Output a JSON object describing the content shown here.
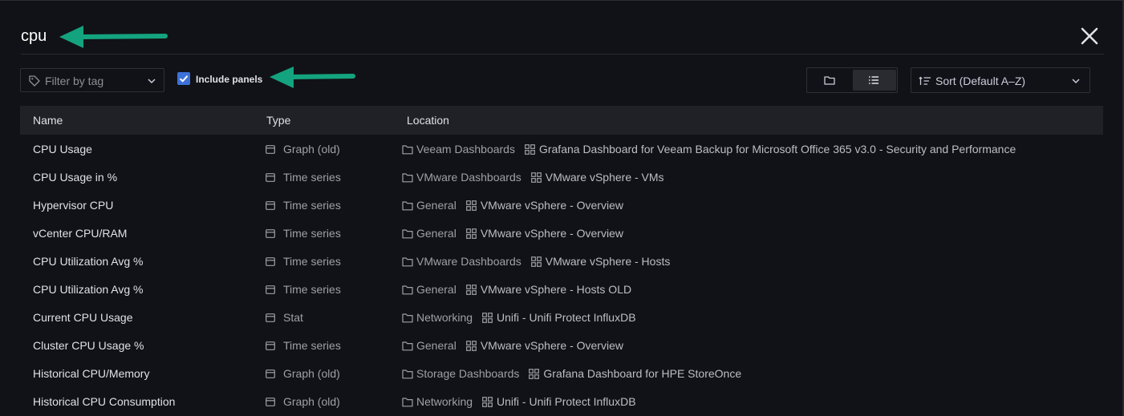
{
  "search": {
    "query": "cpu"
  },
  "filter": {
    "tag_placeholder": "Filter by tag",
    "include_panels_label": "Include panels",
    "include_panels_checked": true
  },
  "sort": {
    "label": "Sort (Default A–Z)"
  },
  "columns": {
    "name": "Name",
    "type": "Type",
    "location": "Location"
  },
  "colors": {
    "accent_arrow": "#14a37f",
    "checkbox": "#3d71d9",
    "background": "#111217",
    "header": "#202127"
  },
  "icons": {
    "close": "close-icon",
    "tag": "tag-icon",
    "folder_view": "folder-view-icon",
    "list_view": "list-view-icon",
    "sort": "sort-icon",
    "panel": "panel-icon",
    "folder": "folder-icon",
    "dashboard": "dashboard-grid-icon"
  },
  "rows": [
    {
      "name": "CPU Usage",
      "type": "Graph (old)",
      "folder": "Veeam Dashboards",
      "dashboard": "Grafana Dashboard for Veeam Backup for Microsoft Office 365 v3.0 - Security and Performance"
    },
    {
      "name": "CPU Usage in %",
      "type": "Time series",
      "folder": "VMware Dashboards",
      "dashboard": "VMware vSphere - VMs"
    },
    {
      "name": "Hypervisor CPU",
      "type": "Time series",
      "folder": "General",
      "dashboard": "VMware vSphere - Overview"
    },
    {
      "name": "vCenter CPU/RAM",
      "type": "Time series",
      "folder": "General",
      "dashboard": "VMware vSphere - Overview"
    },
    {
      "name": "CPU Utilization Avg %",
      "type": "Time series",
      "folder": "VMware Dashboards",
      "dashboard": "VMware vSphere - Hosts"
    },
    {
      "name": "CPU Utilization Avg %",
      "type": "Time series",
      "folder": "General",
      "dashboard": "VMware vSphere - Hosts OLD"
    },
    {
      "name": "Current CPU Usage",
      "type": "Stat",
      "folder": "Networking",
      "dashboard": "Unifi - Unifi Protect InfluxDB"
    },
    {
      "name": "Cluster CPU Usage %",
      "type": "Time series",
      "folder": "General",
      "dashboard": "VMware vSphere - Overview"
    },
    {
      "name": "Historical CPU/Memory",
      "type": "Graph (old)",
      "folder": "Storage Dashboards",
      "dashboard": "Grafana Dashboard for HPE StoreOnce"
    },
    {
      "name": "Historical CPU Consumption",
      "type": "Graph (old)",
      "folder": "Networking",
      "dashboard": "Unifi - Unifi Protect InfluxDB"
    }
  ]
}
